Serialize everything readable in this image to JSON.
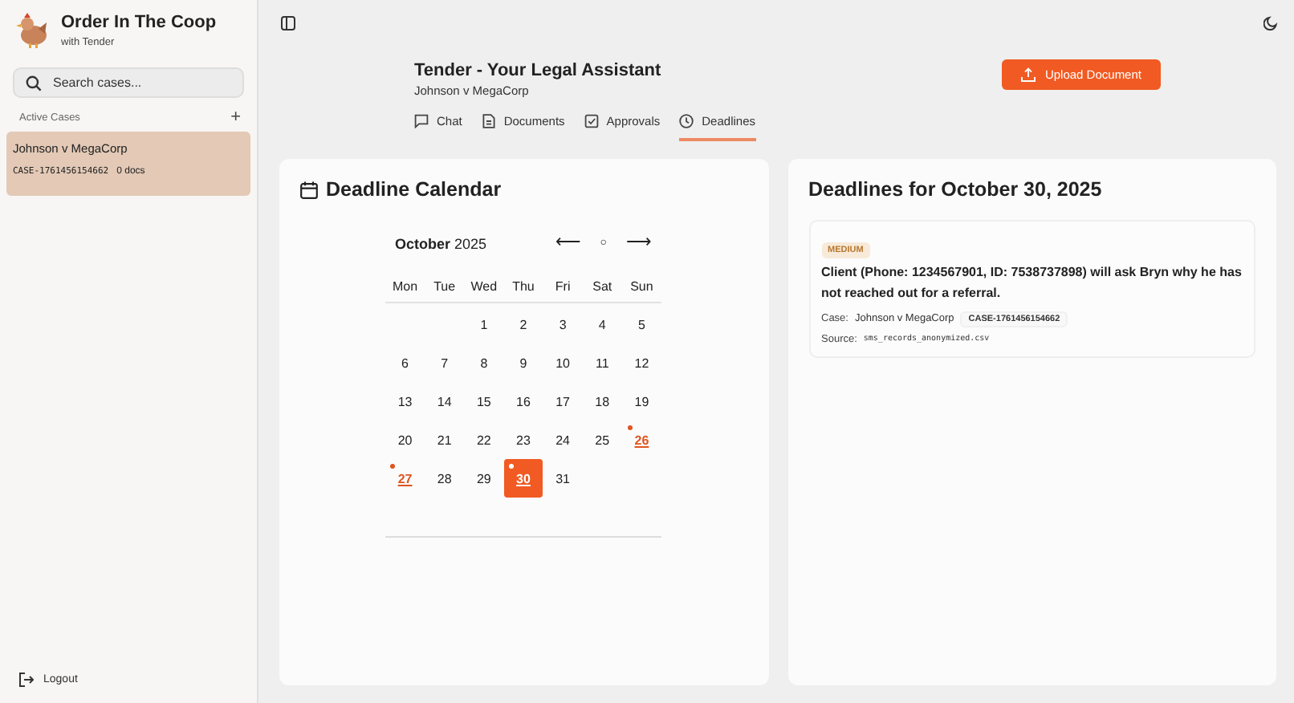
{
  "app": {
    "name": "Order In The Coop",
    "subtitle": "with Tender"
  },
  "sidebar": {
    "search": {
      "placeholder": "Search cases..."
    },
    "section_label": "Active Cases",
    "add_label": "+",
    "cases": [
      {
        "name": "Johnson v MegaCorp",
        "case_id": "CASE-1761456154662",
        "docs": "0 docs",
        "selected": true
      }
    ],
    "logout": "Logout"
  },
  "header": {
    "title": "Tender - Your Legal Assistant",
    "subtitle": "Johnson v MegaCorp",
    "upload_button": "Upload Document",
    "tabs": [
      {
        "label": "Chat",
        "selected": false
      },
      {
        "label": "Documents",
        "selected": false
      },
      {
        "label": "Approvals",
        "selected": false
      },
      {
        "label": "Deadlines",
        "selected": true
      }
    ]
  },
  "calendar": {
    "title": "Deadline Calendar",
    "month": "October",
    "year": "2025",
    "prev": "⟵",
    "today": "○",
    "next": "⟶",
    "weekdays": [
      "Mon",
      "Tue",
      "Wed",
      "Thu",
      "Fri",
      "Sat",
      "Sun"
    ],
    "weeks": [
      [
        {
          "day": "1",
          "marked": false,
          "selected": false
        },
        {
          "day": "2",
          "marked": false,
          "selected": false
        },
        {
          "day": "3",
          "marked": false,
          "selected": false
        },
        {
          "day": "4",
          "marked": false,
          "selected": false
        },
        {
          "day": "5",
          "marked": false,
          "selected": false
        }
      ],
      [
        {
          "day": "6",
          "marked": false,
          "selected": false
        },
        {
          "day": "7",
          "marked": false,
          "selected": false
        },
        {
          "day": "8",
          "marked": false,
          "selected": false
        },
        {
          "day": "9",
          "marked": false,
          "selected": false
        },
        {
          "day": "10",
          "marked": false,
          "selected": false
        },
        {
          "day": "11",
          "marked": false,
          "selected": false
        },
        {
          "day": "12",
          "marked": false,
          "selected": false
        }
      ],
      [
        {
          "day": "13",
          "marked": false,
          "selected": false
        },
        {
          "day": "14",
          "marked": false,
          "selected": false
        },
        {
          "day": "15",
          "marked": false,
          "selected": false
        },
        {
          "day": "16",
          "marked": false,
          "selected": false
        },
        {
          "day": "17",
          "marked": false,
          "selected": false
        },
        {
          "day": "18",
          "marked": false,
          "selected": false
        },
        {
          "day": "19",
          "marked": false,
          "selected": false
        }
      ],
      [
        {
          "day": "20",
          "marked": false,
          "selected": false
        },
        {
          "day": "21",
          "marked": false,
          "selected": false
        },
        {
          "day": "22",
          "marked": false,
          "selected": false
        },
        {
          "day": "23",
          "marked": false,
          "selected": false
        },
        {
          "day": "24",
          "marked": false,
          "selected": false
        },
        {
          "day": "25",
          "marked": false,
          "selected": false
        },
        {
          "day": "26",
          "marked": true,
          "selected": false
        }
      ],
      [
        {
          "day": "27",
          "marked": true,
          "selected": false
        },
        {
          "day": "28",
          "marked": false,
          "selected": false
        },
        {
          "day": "29",
          "marked": false,
          "selected": false
        },
        {
          "day": "30",
          "marked": true,
          "selected": true
        },
        {
          "day": "31",
          "marked": false,
          "selected": false
        }
      ]
    ]
  },
  "deadlines": {
    "title": "Deadlines for October 30, 2025",
    "items": [
      {
        "priority": "MEDIUM",
        "text": "Client (Phone: 1234567901, ID: 7538737898) will ask Bryn why he has not reached out for a referral.",
        "case_label": "Case:",
        "case_name": "Johnson v MegaCorp",
        "case_id": "CASE-1761456154662",
        "source_label": "Source:",
        "source": "sms_records_anonymized.csv"
      }
    ]
  }
}
